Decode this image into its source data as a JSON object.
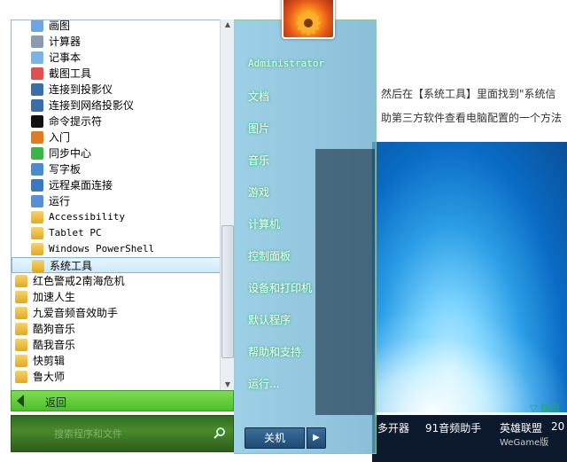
{
  "background": {
    "line1": "然后在【系统工具】里面找到\"系统信",
    "line2": "助第三方软件查看电脑配置的一个方法",
    "kuaijian": "▽ 快剪",
    "taskbar": [
      {
        "label": "多开器",
        "sub": ""
      },
      {
        "label": "91音频助手",
        "sub": ""
      },
      {
        "label": "英雄联盟",
        "sub": "WeGame版"
      },
      {
        "label": "20",
        "sub": ""
      }
    ]
  },
  "start_menu": {
    "programs": [
      {
        "label": "画图",
        "icon": "paint-icon",
        "mono": false
      },
      {
        "label": "计算器",
        "icon": "calculator-icon",
        "mono": false
      },
      {
        "label": "记事本",
        "icon": "notepad-icon",
        "mono": false
      },
      {
        "label": "截图工具",
        "icon": "snipping-icon",
        "mono": false
      },
      {
        "label": "连接到投影仪",
        "icon": "projector-icon",
        "mono": false
      },
      {
        "label": "连接到网络投影仪",
        "icon": "network-projector-icon",
        "mono": false
      },
      {
        "label": "命令提示符",
        "icon": "cmd-icon",
        "mono": false
      },
      {
        "label": "入门",
        "icon": "getting-started-icon",
        "mono": false
      },
      {
        "label": "同步中心",
        "icon": "sync-icon",
        "mono": false
      },
      {
        "label": "写字板",
        "icon": "wordpad-icon",
        "mono": false
      },
      {
        "label": "远程桌面连接",
        "icon": "remote-desktop-icon",
        "mono": false
      },
      {
        "label": "运行",
        "icon": "run-icon",
        "mono": false
      },
      {
        "label": "Accessibility",
        "icon": "folder-icon",
        "mono": true
      },
      {
        "label": "Tablet PC",
        "icon": "folder-icon",
        "mono": true
      },
      {
        "label": "Windows PowerShell",
        "icon": "folder-icon",
        "mono": true
      },
      {
        "label": "系统工具",
        "icon": "folder-icon",
        "mono": false,
        "selected": true
      },
      {
        "label": "红色警戒2南海危机",
        "icon": "folder-icon",
        "mono": false,
        "outdent": true
      },
      {
        "label": "加速人生",
        "icon": "folder-icon",
        "mono": false,
        "outdent": true
      },
      {
        "label": "九爱音频音效助手",
        "icon": "folder-icon",
        "mono": false,
        "outdent": true
      },
      {
        "label": "酷狗音乐",
        "icon": "folder-icon",
        "mono": false,
        "outdent": true
      },
      {
        "label": "酷我音乐",
        "icon": "folder-icon",
        "mono": false,
        "outdent": true
      },
      {
        "label": "快剪辑",
        "icon": "folder-icon",
        "mono": false,
        "outdent": true
      },
      {
        "label": "鲁大师",
        "icon": "folder-icon",
        "mono": false,
        "outdent": true
      }
    ],
    "back_label": "返回",
    "search_placeholder": "搜索程序和文件",
    "user": "Administrator",
    "right_items": [
      "文档",
      "图片",
      "音乐",
      "游戏",
      "计算机",
      "控制面板",
      "设备和打印机",
      "默认程序",
      "帮助和支持",
      "运行..."
    ],
    "shutdown_label": "关机",
    "colors": {
      "accent": "#4bbf2a",
      "selected_row": "#cde9fb"
    }
  }
}
